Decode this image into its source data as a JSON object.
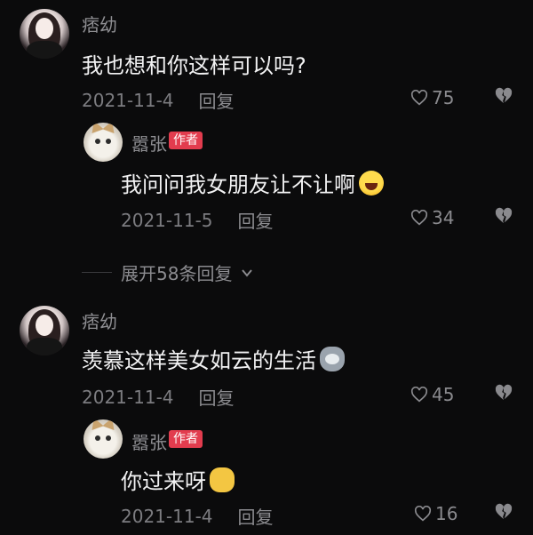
{
  "comments": [
    {
      "user": "痞幼",
      "text": "我也想和你这样可以吗?",
      "date": "2021-11-4",
      "reply_label": "回复",
      "likes": "75"
    },
    {
      "user": "嚣张",
      "badge": "作者",
      "text": "我问问我女朋友让不让啊",
      "date": "2021-11-5",
      "reply_label": "回复",
      "likes": "34"
    },
    {
      "user": "痞幼",
      "text": "羡慕这样美女如云的生活",
      "date": "2021-11-4",
      "reply_label": "回复",
      "likes": "45"
    },
    {
      "user": "嚣张",
      "badge": "作者",
      "text": "你过来呀",
      "date": "2021-11-4",
      "reply_label": "回复",
      "likes": "16"
    }
  ],
  "expand_replies": "展开58条回复",
  "colors": {
    "background": "#0b0b0c",
    "badge": "#e23c4e",
    "muted_text": "#8f8f93"
  }
}
